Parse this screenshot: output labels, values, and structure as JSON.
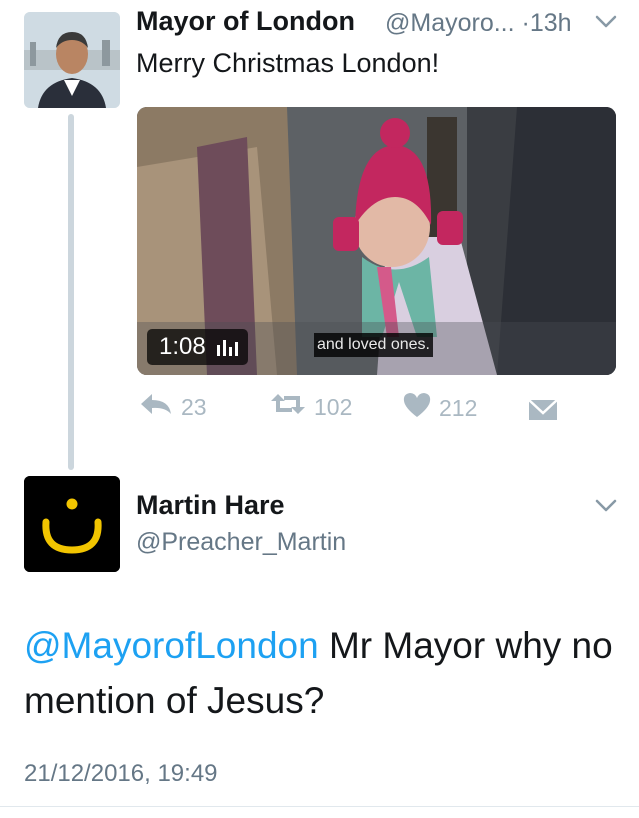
{
  "tweet1": {
    "author_name": "Mayor of London",
    "handle": "@Mayoro...",
    "separator": "·",
    "time": "13h",
    "text": "Merry Christmas London!",
    "video": {
      "duration": "1:08",
      "subtitle": "and loved ones."
    },
    "actions": {
      "replies": "23",
      "retweets": "102",
      "likes": "212"
    }
  },
  "tweet2": {
    "author_name": "Martin Hare",
    "handle": "@Preacher_Martin",
    "avatar_glyph": "ن",
    "mention": "@MayorofLondon",
    "text": " Mr Mayor why no mention of Jesus?",
    "date": "21/12/2016, 19:49"
  },
  "colors": {
    "link": "#1da1f2",
    "muted": "#657786",
    "icon": "#aab8c2",
    "avatar_glyph": "#f2c500"
  }
}
